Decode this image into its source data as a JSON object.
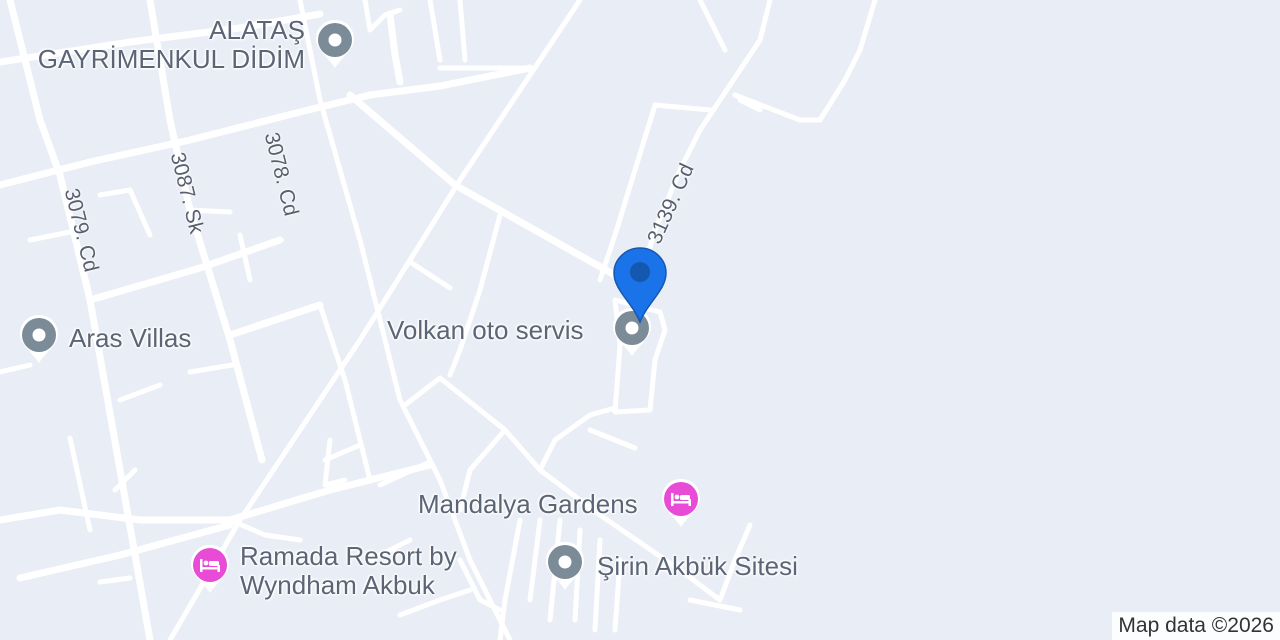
{
  "map": {
    "background_color": "#e9edf5",
    "road_color": "#ffffff",
    "label_color": "#5b6577"
  },
  "streets": [
    {
      "id": "3139-cd",
      "label": "3139. Cd"
    },
    {
      "id": "3079-cd",
      "label": "3079. Cd"
    },
    {
      "id": "3087-sk",
      "label": "3087. Sk"
    },
    {
      "id": "3078-cd",
      "label": "3078. Cd"
    }
  ],
  "places": [
    {
      "id": "alatas",
      "label_line1": "ALATAŞ",
      "label_line2": "GAYRİMENKUL DİDİM",
      "icon": "pin-dot-icon",
      "color": "#7b8b97"
    },
    {
      "id": "aras",
      "label": "Aras Villas",
      "icon": "pin-dot-icon",
      "color": "#7b8b97"
    },
    {
      "id": "volkan",
      "label": "Volkan oto servis",
      "icon": "pin-dot-icon",
      "color": "#7b8b97"
    },
    {
      "id": "mandalya",
      "label": "Mandalya Gardens",
      "icon": "hotel-bed-icon",
      "color": "#e84bd6"
    },
    {
      "id": "ramada",
      "label_line1": "Ramada Resort by",
      "label_line2": "Wyndham Akbuk",
      "icon": "hotel-bed-icon",
      "color": "#e84bd6"
    },
    {
      "id": "sirin",
      "label": "Şirin Akbük Sitesi",
      "icon": "pin-dot-icon",
      "color": "#7b8b97"
    }
  ],
  "marker": {
    "icon": "location-pin-icon",
    "color": "#1a73e8",
    "dot_color": "#1558b0"
  },
  "attribution": "Map data ©2026"
}
